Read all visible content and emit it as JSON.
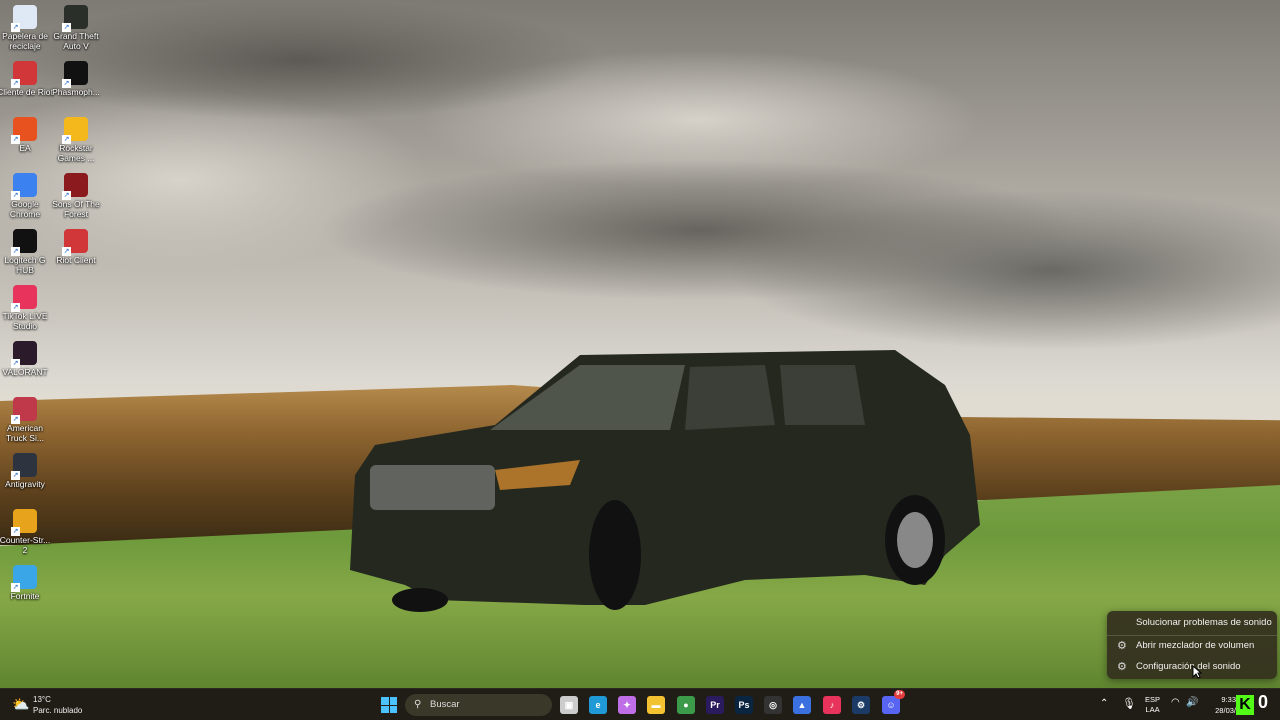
{
  "desktop": {
    "icons": [
      {
        "label": "Papelera de reciclaje",
        "icon": "recycle-bin-icon",
        "color": "#dfe9f5"
      },
      {
        "label": "Grand Theft Auto V",
        "icon": "gta-icon",
        "color": "#2b2f2a"
      },
      {
        "label": "Cliente de Riot",
        "icon": "riot-icon",
        "color": "#d13639"
      },
      {
        "label": "Phasmoph...",
        "icon": "phasmophobia-icon",
        "color": "#111111"
      },
      {
        "label": "EA",
        "icon": "ea-icon",
        "color": "#e8521f"
      },
      {
        "label": "Rockstar Games ...",
        "icon": "rockstar-icon",
        "color": "#f4b71c"
      },
      {
        "label": "Google Chrome",
        "icon": "chrome-icon",
        "color": "#3b82f0"
      },
      {
        "label": "Sons Of The Forest",
        "icon": "sons-forest-icon",
        "color": "#8a1a1e"
      },
      {
        "label": "Logitech G HUB",
        "icon": "logitech-icon",
        "color": "#111111"
      },
      {
        "label": "Riot Client",
        "icon": "riot-client-icon",
        "color": "#d13639"
      },
      {
        "label": "TikTok LIVE Studio",
        "icon": "tiktok-live-icon",
        "color": "#e8345c"
      },
      {
        "label": "VALORANT",
        "icon": "valorant-icon",
        "color": "#2a1a2a"
      },
      {
        "label": "American Truck Si...",
        "icon": "truck-icon",
        "color": "#c0394a"
      },
      {
        "label": "Antigravity",
        "icon": "antigravity-icon",
        "color": "#2e3340"
      },
      {
        "label": "Counter-Str... 2",
        "icon": "cs2-icon",
        "color": "#e8a31c"
      },
      {
        "label": "Fortnite",
        "icon": "fortnite-icon",
        "color": "#3aa6e8"
      }
    ]
  },
  "context_menu": {
    "items": [
      {
        "label": "Solucionar problemas de sonido",
        "icon": ""
      },
      {
        "label": "Abrir mezclador de volumen",
        "icon": "gear-icon"
      },
      {
        "label": "Configuración del sonido",
        "icon": "gear-icon"
      }
    ]
  },
  "taskbar": {
    "weather": {
      "temp": "13°C",
      "desc": "Parc. nublado"
    },
    "search_placeholder": "Buscar",
    "apps": [
      {
        "name": "task-view",
        "glyph": "▣",
        "color": "#cccccc"
      },
      {
        "name": "edge",
        "glyph": "e",
        "color": "#1f9ad6"
      },
      {
        "name": "copilot",
        "glyph": "✦",
        "color": "#c06ee8"
      },
      {
        "name": "file-explorer",
        "glyph": "▬",
        "color": "#f2c230"
      },
      {
        "name": "chrome",
        "glyph": "●",
        "color": "#3b9b4a"
      },
      {
        "name": "premiere",
        "glyph": "Pr",
        "color": "#2a1a5e"
      },
      {
        "name": "photoshop",
        "glyph": "Ps",
        "color": "#0a2540"
      },
      {
        "name": "obs",
        "glyph": "◎",
        "color": "#333333"
      },
      {
        "name": "antigravity",
        "glyph": "▲",
        "color": "#3a70e0"
      },
      {
        "name": "tiktok",
        "glyph": "♪",
        "color": "#e8345c"
      },
      {
        "name": "steam",
        "glyph": "⚙",
        "color": "#1b3a66"
      },
      {
        "name": "discord",
        "glyph": "☺",
        "color": "#5865f2"
      }
    ],
    "discord_badge": "9+",
    "lang": {
      "top": "ESP",
      "bottom": "LAA"
    },
    "time": "9:33",
    "date": "28/03/",
    "notification_count": "0"
  }
}
